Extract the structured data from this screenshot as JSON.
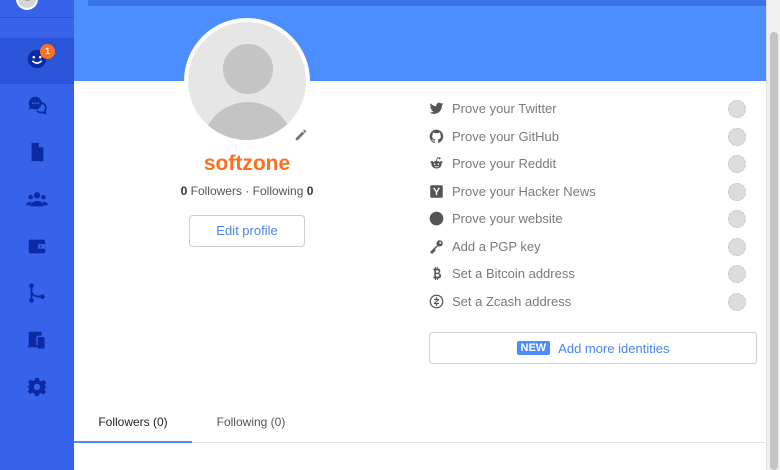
{
  "colors": {
    "sidebar": "#3663ea",
    "banner": "#4c8dff",
    "accent_orange": "#ff6f21",
    "link_blue": "#4b86f0"
  },
  "sidebar": {
    "items": [
      {
        "icon": "people-chat-icon",
        "badge": "1",
        "active": true
      },
      {
        "icon": "chat-bubbles-icon"
      },
      {
        "icon": "file-icon"
      },
      {
        "icon": "teams-icon"
      },
      {
        "icon": "wallet-icon"
      },
      {
        "icon": "git-branch-icon"
      },
      {
        "icon": "devices-icon"
      },
      {
        "icon": "gear-icon"
      }
    ]
  },
  "profile": {
    "username": "softzone",
    "followers_count": "0",
    "followers_label": "Followers",
    "separator": "·",
    "following_label": "Following",
    "following_count": "0",
    "edit_button": "Edit profile"
  },
  "proofs": [
    {
      "icon": "twitter-icon",
      "label": "Prove your Twitter"
    },
    {
      "icon": "github-icon",
      "label": "Prove your GitHub"
    },
    {
      "icon": "reddit-icon",
      "label": "Prove your Reddit"
    },
    {
      "icon": "hackernews-icon",
      "label": "Prove your Hacker News"
    },
    {
      "icon": "globe-icon",
      "label": "Prove your website"
    },
    {
      "icon": "key-icon",
      "label": "Add a PGP key"
    },
    {
      "icon": "bitcoin-icon",
      "label": "Set a Bitcoin address"
    },
    {
      "icon": "zcash-icon",
      "label": "Set a Zcash address"
    }
  ],
  "add_identities": {
    "badge": "NEW",
    "label": "Add more identities"
  },
  "tabs": [
    {
      "label": "Followers (0)",
      "active": true
    },
    {
      "label": "Following (0)"
    }
  ]
}
